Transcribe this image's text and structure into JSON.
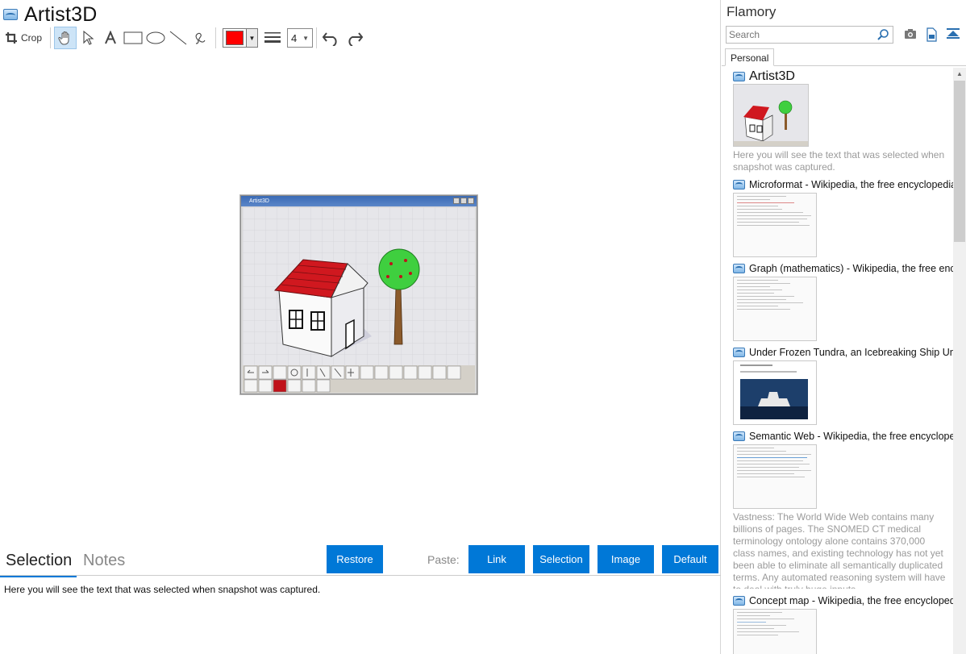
{
  "main": {
    "title": "Artist3D",
    "toolbar": {
      "crop_label": "Crop",
      "line_width": "4",
      "stroke_color": "#ff0000"
    },
    "snapshot": {
      "window_title": "Artist3D"
    },
    "bottom": {
      "tabs": [
        "Selection",
        "Notes"
      ],
      "restore_label": "Restore",
      "paste_label": "Paste:",
      "paste_buttons": [
        "Link",
        "Selection",
        "Image",
        "Default"
      ],
      "selection_text": "Here you will see the text that was selected when snapshot was captured."
    }
  },
  "sidebar": {
    "title": "Flamory",
    "search_placeholder": "Search",
    "tabs": [
      "Personal"
    ],
    "items": [
      {
        "title": "Artist3D",
        "description": "Here you will see the text that was selected when snapshot was captured."
      },
      {
        "title": "Microformat - Wikipedia, the free encyclopedia"
      },
      {
        "title": "Graph (mathematics) - Wikipedia, the free encyc"
      },
      {
        "title": "Under Frozen Tundra, an Icebreaking Ship Unco"
      },
      {
        "title": "Semantic Web - Wikipedia, the free encycloped",
        "description": "Vastness: The World Wide Web contains many billions of pages. The SNOMED CT medical terminology ontology alone contains 370,000 class names, and existing technology has not yet been able to eliminate all semantically duplicated terms. Any automated reasoning system will have to deal with truly huge inputs."
      },
      {
        "title": "Concept map - Wikipedia, the free encyclopedia"
      }
    ]
  },
  "colors": {
    "accent": "#0078d7",
    "muted_text": "#9a9a9a"
  }
}
